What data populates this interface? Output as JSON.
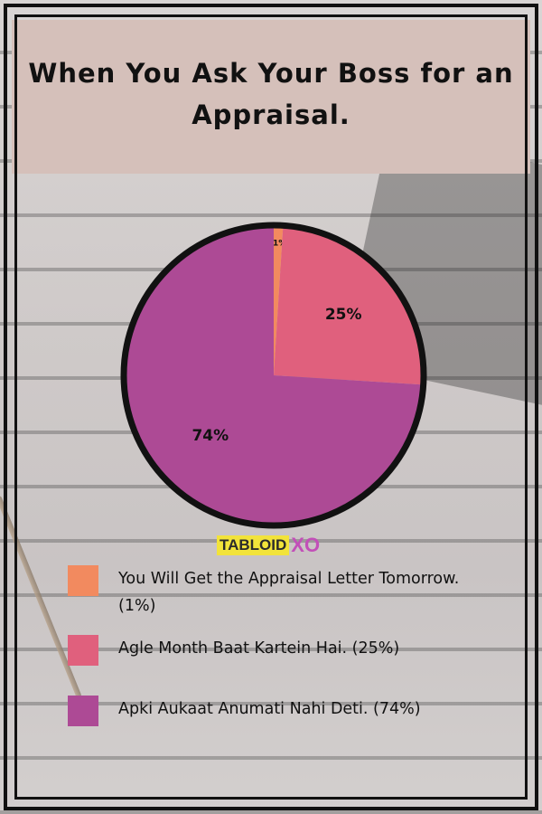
{
  "title": "When You Ask Your Boss for an Appraisal.",
  "logo": {
    "main": "TABLOID",
    "accent": "XO"
  },
  "colors": {
    "header_bg": "#d5c0ba",
    "slice_1": "#f28a5f",
    "slice_2": "#e0607d",
    "slice_3": "#ad4a95",
    "pie_border": "#111111"
  },
  "chart_data": {
    "type": "pie",
    "categories": [
      "You Will Get the Appraisal Letter Tomorrow. (1%)",
      "Agle Month Baat Kartein Hai. (25%)",
      "Apki Aukaat Anumati Nahi Deti. (74%)"
    ],
    "values": [
      1,
      25,
      74
    ],
    "labels": [
      "1%",
      "25%",
      "74%"
    ],
    "colors": [
      "#f28a5f",
      "#e0607d",
      "#ad4a95"
    ],
    "title": "When You Ask Your Boss for an Appraisal.",
    "legend_position": "bottom"
  }
}
